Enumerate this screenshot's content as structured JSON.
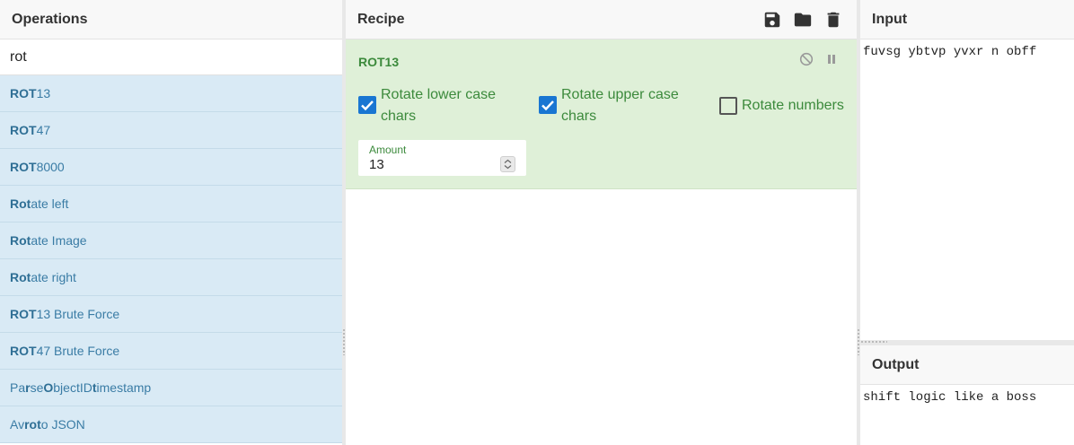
{
  "operations": {
    "title": "Operations",
    "search_value": "rot",
    "items": [
      {
        "match": "ROT",
        "rest": "13"
      },
      {
        "match": "ROT",
        "rest": "47"
      },
      {
        "match": "ROT",
        "rest": "8000"
      },
      {
        "match": "Rot",
        "rest": "ate left"
      },
      {
        "match": "Rot",
        "rest": "ate Image"
      },
      {
        "match": "Rot",
        "rest": "ate right"
      },
      {
        "match": "ROT",
        "rest": "13 Brute Force"
      },
      {
        "match": "ROT",
        "rest": "47 Brute Force"
      }
    ],
    "parse_item": {
      "p1": "Pa",
      "b1": "r",
      "p2": "se ",
      "b2": "O",
      "p3": "bjectID ",
      "b3": "t",
      "p4": "imestamp"
    },
    "avro_item": {
      "p1": "Av",
      "b1": "ro",
      "p2": " ",
      "b2": "t",
      "p3": "o JSON"
    }
  },
  "recipe": {
    "title": "Recipe",
    "icons": [
      "save-icon",
      "folder-icon",
      "trash-icon"
    ],
    "operation": {
      "name": "ROT13",
      "disable_icon": "disable-icon",
      "pause_icon": "pause-icon",
      "lower_label_1": "Rotate lower case",
      "lower_label_2": "chars",
      "lower_checked": true,
      "upper_label_1": "Rotate upper case",
      "upper_label_2": "chars",
      "upper_checked": true,
      "numbers_label": "Rotate numbers",
      "numbers_checked": false,
      "amount_label": "Amount",
      "amount_value": "13"
    }
  },
  "input": {
    "title": "Input",
    "text": "fuvsg ybtvp yvxr n obff"
  },
  "output": {
    "title": "Output",
    "text": "shift logic like a boss"
  },
  "colors": {
    "op_item_bg": "#d9eaf5",
    "op_card_bg": "#dff0d8",
    "op_card_text": "#3c8a3c",
    "checkbox_on": "#1976d2"
  }
}
